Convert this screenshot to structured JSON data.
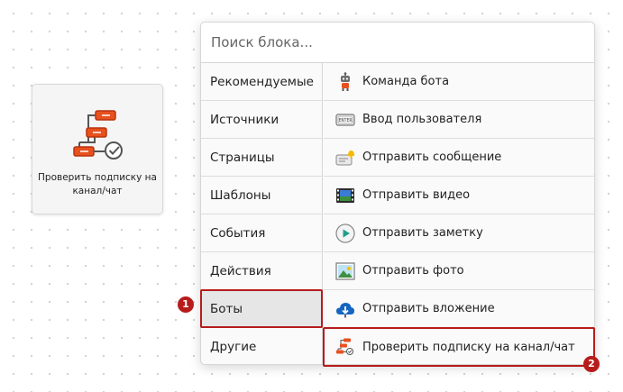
{
  "node": {
    "label": "Проверить подписку на канал/чат",
    "icon": "check-subscription-flow-icon"
  },
  "picker": {
    "search_placeholder": "Поиск блока...",
    "categories": [
      {
        "label": "Рекомендуемые"
      },
      {
        "label": "Источники"
      },
      {
        "label": "Страницы"
      },
      {
        "label": "Шаблоны"
      },
      {
        "label": "События"
      },
      {
        "label": "Действия"
      },
      {
        "label": "Боты",
        "selected": true
      },
      {
        "label": "Другие"
      }
    ],
    "blocks": [
      {
        "label": "Команда бота",
        "icon": "robot-icon"
      },
      {
        "label": "Ввод пользователя",
        "icon": "enter-key-icon"
      },
      {
        "label": "Отправить сообщение",
        "icon": "message-bell-icon"
      },
      {
        "label": "Отправить видео",
        "icon": "video-film-icon"
      },
      {
        "label": "Отправить заметку",
        "icon": "play-circle-icon"
      },
      {
        "label": "Отправить фото",
        "icon": "photo-icon"
      },
      {
        "label": "Отправить вложение",
        "icon": "cloud-download-icon"
      },
      {
        "label": "Проверить подписку на канал/чат",
        "icon": "check-subscription-icon",
        "selected": true
      }
    ]
  },
  "annotations": {
    "badge_1": "1",
    "badge_2": "2"
  },
  "colors": {
    "highlight": "#b71c1c",
    "accent_orange": "#e8501e"
  }
}
